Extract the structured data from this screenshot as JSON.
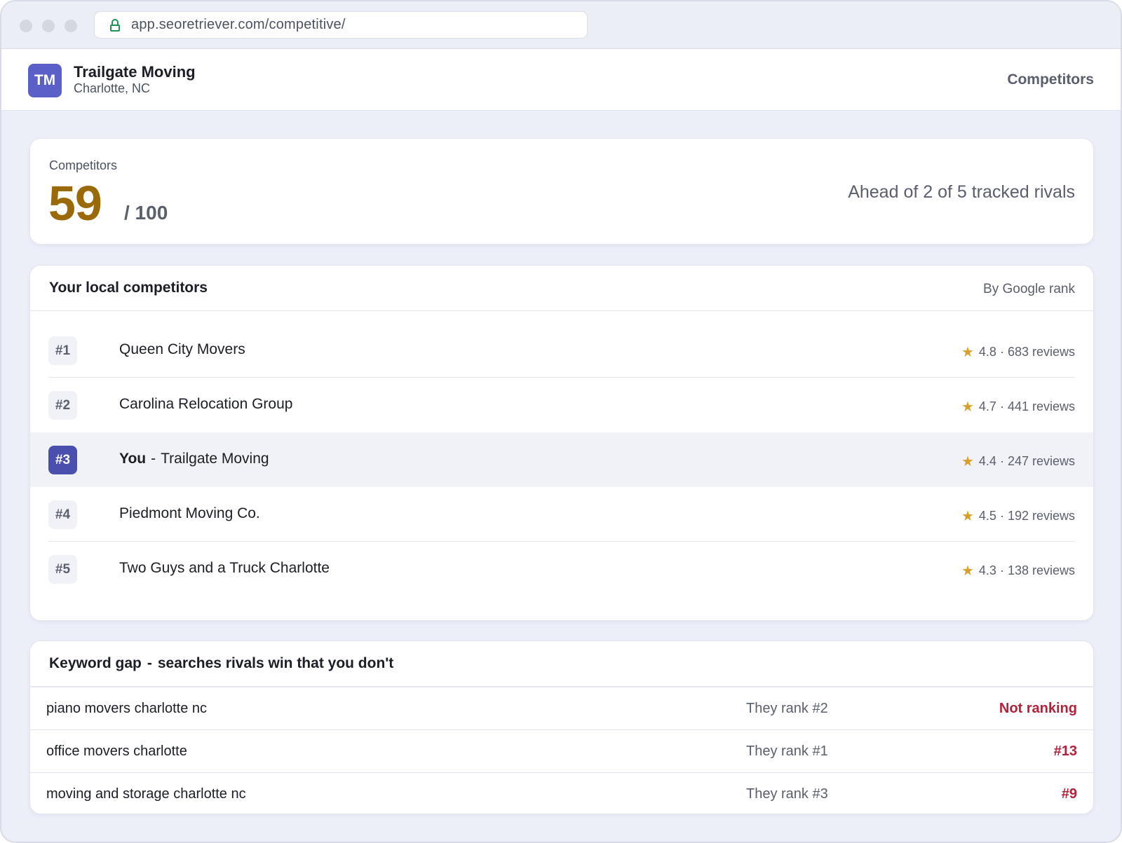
{
  "browser": {
    "url": "app.seoretriever.com/competitive/"
  },
  "header": {
    "avatar_initials": "TM",
    "business_name": "Trailgate Moving",
    "location": "Charlotte, NC",
    "section_title": "Competitors"
  },
  "score": {
    "label": "Competitors",
    "value": "59",
    "max": "/ 100",
    "summary": "Ahead of 2 of 5 tracked rivals"
  },
  "competitors": {
    "title": "Your local competitors",
    "sort_label": "By Google rank",
    "you_label": "You",
    "rows": [
      {
        "rank": "#1",
        "name": "Queen City Movers",
        "rating": "4.8 · 683 reviews",
        "is_you": false
      },
      {
        "rank": "#2",
        "name": "Carolina Relocation Group",
        "rating": "4.7 · 441 reviews",
        "is_you": false
      },
      {
        "rank": "#3",
        "name": "Trailgate Moving",
        "rating": "4.4 · 247 reviews",
        "is_you": true
      },
      {
        "rank": "#4",
        "name": "Piedmont Moving Co.",
        "rating": "4.5 · 192 reviews",
        "is_you": false
      },
      {
        "rank": "#5",
        "name": "Two Guys and a Truck Charlotte",
        "rating": "4.3 · 138 reviews",
        "is_you": false
      }
    ]
  },
  "keyword_gap": {
    "title": "Keyword gap",
    "subtitle": "searches rivals win that you don't",
    "rows": [
      {
        "term": "piano movers charlotte nc",
        "they": "They rank #2",
        "you": "Not ranking"
      },
      {
        "term": "office movers charlotte",
        "they": "They rank #1",
        "you": "#13"
      },
      {
        "term": "moving and storage charlotte nc",
        "they": "They rank #3",
        "you": "#9"
      }
    ]
  },
  "colors": {
    "accent": "#4a4fae",
    "score": "#9a6a0a",
    "star": "#d8a02a",
    "negative": "#b3213b"
  }
}
